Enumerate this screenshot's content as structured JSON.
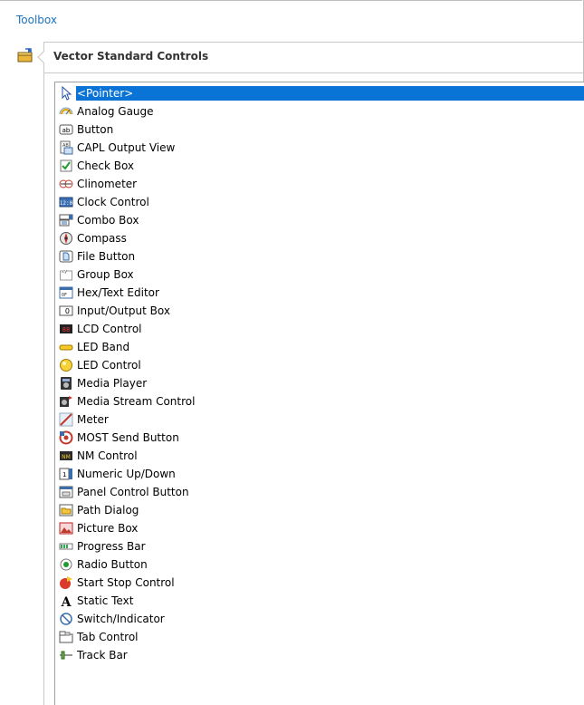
{
  "toolbox": {
    "title": "Toolbox",
    "section_title": "Vector Standard Controls"
  },
  "items": [
    {
      "label": "<Pointer>",
      "icon": "pointer-icon",
      "selected": true
    },
    {
      "label": "Analog Gauge",
      "icon": "analog-gauge-icon"
    },
    {
      "label": "Button",
      "icon": "button-icon"
    },
    {
      "label": "CAPL Output View",
      "icon": "capl-output-view-icon"
    },
    {
      "label": "Check Box",
      "icon": "check-box-icon"
    },
    {
      "label": "Clinometer",
      "icon": "clinometer-icon"
    },
    {
      "label": "Clock Control",
      "icon": "clock-control-icon"
    },
    {
      "label": "Combo Box",
      "icon": "combo-box-icon"
    },
    {
      "label": "Compass",
      "icon": "compass-icon"
    },
    {
      "label": "File Button",
      "icon": "file-button-icon"
    },
    {
      "label": "Group Box",
      "icon": "group-box-icon"
    },
    {
      "label": "Hex/Text Editor",
      "icon": "hex-text-editor-icon"
    },
    {
      "label": "Input/Output Box",
      "icon": "input-output-box-icon"
    },
    {
      "label": "LCD Control",
      "icon": "lcd-control-icon"
    },
    {
      "label": "LED Band",
      "icon": "led-band-icon"
    },
    {
      "label": "LED Control",
      "icon": "led-control-icon"
    },
    {
      "label": "Media Player",
      "icon": "media-player-icon"
    },
    {
      "label": "Media Stream Control",
      "icon": "media-stream-control-icon"
    },
    {
      "label": "Meter",
      "icon": "meter-icon"
    },
    {
      "label": "MOST Send Button",
      "icon": "most-send-button-icon"
    },
    {
      "label": "NM Control",
      "icon": "nm-control-icon"
    },
    {
      "label": "Numeric Up/Down",
      "icon": "numeric-up-down-icon"
    },
    {
      "label": "Panel Control Button",
      "icon": "panel-control-button-icon"
    },
    {
      "label": "Path Dialog",
      "icon": "path-dialog-icon"
    },
    {
      "label": "Picture Box",
      "icon": "picture-box-icon"
    },
    {
      "label": "Progress Bar",
      "icon": "progress-bar-icon"
    },
    {
      "label": "Radio Button",
      "icon": "radio-button-icon"
    },
    {
      "label": "Start Stop Control",
      "icon": "start-stop-control-icon"
    },
    {
      "label": "Static Text",
      "icon": "static-text-icon"
    },
    {
      "label": "Switch/Indicator",
      "icon": "switch-indicator-icon"
    },
    {
      "label": "Tab Control",
      "icon": "tab-control-icon"
    },
    {
      "label": "Track Bar",
      "icon": "track-bar-icon"
    }
  ],
  "colors": {
    "selection": "#0a74d6",
    "title_link": "#1e73be"
  }
}
